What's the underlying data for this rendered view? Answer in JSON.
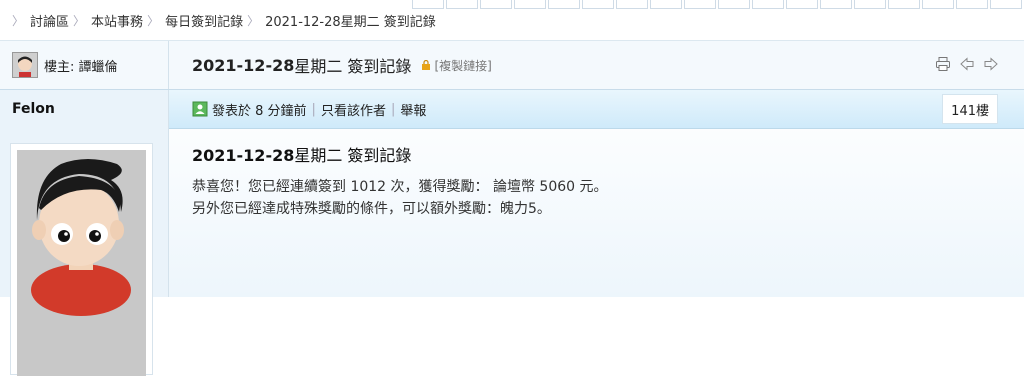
{
  "breadcrumb": [
    "討論區",
    "本站事務",
    "每日簽到記錄",
    "2021-12-28星期二 簽到記錄"
  ],
  "thread": {
    "op_label": "樓主: 譚蠟倫",
    "title_bold": "2021-12-28",
    "title_rest": "星期二 簽到記錄",
    "copy_link": "[複製鏈接]"
  },
  "post": {
    "author": "Felon",
    "meta_time": "發表於 8 分鐘前",
    "meta_only_author": "只看該作者",
    "meta_report": "舉報",
    "floor": "141樓",
    "title_bold": "2021-12-28",
    "title_rest": "星期二 簽到記錄",
    "line1": "恭喜您！您已經連續簽到 1012 次，獲得獎勵： 論壇幣 5060 元。",
    "line2": "另外您已經達成特殊獎勵的條件，可以額外獎勵：魄力5。"
  },
  "icons": {
    "print": "printer-icon",
    "prev": "arrow-left-icon",
    "next": "arrow-right-icon",
    "lock": "lock-icon"
  },
  "colors": {
    "accent": "#cfeafa",
    "lock": "#e8a317",
    "post_icon": "#5cb85c"
  }
}
